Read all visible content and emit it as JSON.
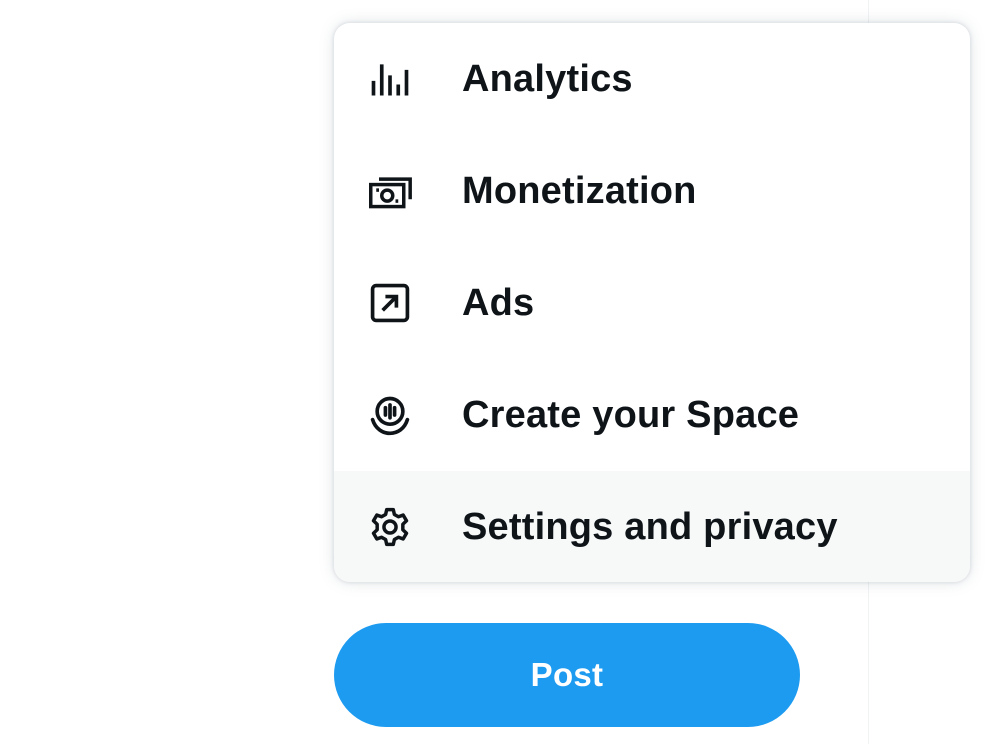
{
  "menu": {
    "items": [
      {
        "label": "Analytics",
        "icon": "analytics-icon"
      },
      {
        "label": "Monetization",
        "icon": "monetization-icon"
      },
      {
        "label": "Ads",
        "icon": "ads-icon"
      },
      {
        "label": "Create your Space",
        "icon": "spaces-icon"
      },
      {
        "label": "Settings and privacy",
        "icon": "gear-icon"
      }
    ]
  },
  "post_button": {
    "label": "Post"
  },
  "colors": {
    "accent": "#1d9bf0",
    "text": "#0f1419",
    "hover_bg": "#f7f9f9"
  }
}
